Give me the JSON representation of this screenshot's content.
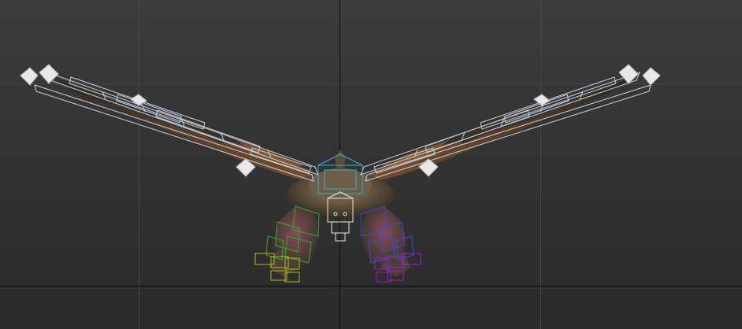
{
  "viewport": {
    "label": "",
    "background": "#333333",
    "grid_color": "#474747",
    "axis_color": "#0d0d0d"
  },
  "scene": {
    "object": "winged-creature-rig",
    "colors": {
      "wing_bones": "#c8d2e0",
      "spine_bones": "#2bb7c9",
      "left_leg_bones": "#2fae2f",
      "left_foot_bones": "#b7b814",
      "right_leg_bones": "#3a4fd6",
      "right_foot_bones": "#9d1ec7",
      "head_bones": "#e6e6e6",
      "body_skin": "#5a4634",
      "wing_skin": "#6a4a30",
      "wing_helper": "#e8e8e8"
    }
  }
}
